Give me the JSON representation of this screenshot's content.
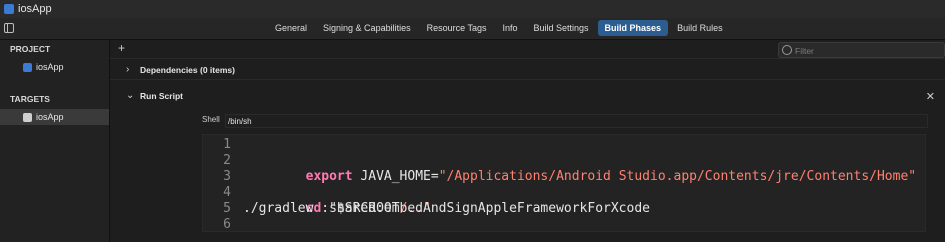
{
  "window": {
    "title": "iosApp"
  },
  "tabs": [
    {
      "label": "General"
    },
    {
      "label": "Signing & Capabilities"
    },
    {
      "label": "Resource Tags"
    },
    {
      "label": "Info"
    },
    {
      "label": "Build Settings"
    },
    {
      "label": "Build Phases",
      "active": true
    },
    {
      "label": "Build Rules"
    }
  ],
  "sidebar": {
    "project_heading": "PROJECT",
    "project_item": "iosApp",
    "targets_heading": "TARGETS",
    "target_item": "iosApp"
  },
  "main": {
    "filter_placeholder": "Filter",
    "dependencies_label": "Dependencies (0 items)",
    "run_script_label": "Run Script",
    "shell_label": "Shell",
    "shell_value": "/bin/sh"
  },
  "script": {
    "lines": [
      {
        "n": "1",
        "parts": []
      },
      {
        "n": "2",
        "parts": [
          {
            "t": "export",
            "kind": "kw"
          },
          {
            "t": " JAVA_HOME=",
            "kind": "plain"
          },
          {
            "t": "\"/Applications/Android Studio.app/Contents/jre/Contents/Home\"",
            "kind": "str"
          }
        ]
      },
      {
        "n": "3",
        "parts": []
      },
      {
        "n": "4",
        "parts": [
          {
            "t": "cd",
            "kind": "kw"
          },
          {
            "t": " \"$SRCROOT",
            "kind": "plain"
          },
          {
            "t": "/..\"",
            "kind": "str"
          }
        ]
      },
      {
        "n": "5",
        "parts": [
          {
            "t": "./gradlew :shared:embedAndSignAppleFrameworkForXcode",
            "kind": "plain"
          }
        ]
      },
      {
        "n": "6",
        "parts": []
      }
    ]
  },
  "colors": {
    "accent_tab": "#2c5d90",
    "keyword": "#ff7ab2",
    "string": "#ff8170"
  },
  "icons": [
    "app-icon",
    "sidebar-toggle-icon",
    "add-icon",
    "filter-icon",
    "chevron-right-icon",
    "chevron-down-icon",
    "close-icon"
  ]
}
